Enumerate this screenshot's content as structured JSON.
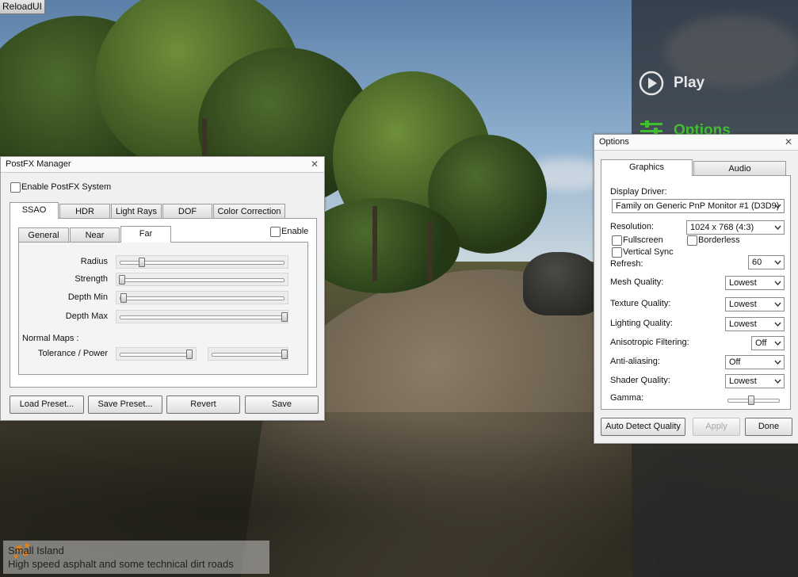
{
  "reload_ui": {
    "label": "ReloadUI"
  },
  "main_menu": {
    "play_label": "Play",
    "options_label": "Options",
    "accent_color": "#3fbf2e"
  },
  "postfx": {
    "title": "PostFX Manager",
    "enable_system_label": "Enable PostFX System",
    "enable_system_checked": false,
    "tabs": [
      {
        "label": "SSAO",
        "active": true
      },
      {
        "label": "HDR",
        "active": false
      },
      {
        "label": "Light Rays",
        "active": false
      },
      {
        "label": "DOF",
        "active": false
      },
      {
        "label": "Color Correction",
        "active": false
      }
    ],
    "subtabs": [
      {
        "label": "General",
        "active": false
      },
      {
        "label": "Near",
        "active": false
      },
      {
        "label": "Far",
        "active": true
      }
    ],
    "enable_label": "Enable",
    "enable_checked": false,
    "sliders": {
      "radius": {
        "label": "Radius",
        "value": 0.15
      },
      "strength": {
        "label": "Strength",
        "value": 0.0
      },
      "depth_min": {
        "label": "Depth Min",
        "value": 0.01
      },
      "depth_max": {
        "label": "Depth Max",
        "value": 1.0
      }
    },
    "normal_maps_label": "Normal Maps :",
    "tolerance_power": {
      "label": "Tolerance / Power",
      "tolerance_value": 0.95,
      "power_value": 1.0
    },
    "buttons": {
      "load_preset": "Load Preset...",
      "save_preset": "Save Preset...",
      "revert": "Revert",
      "save": "Save"
    }
  },
  "options": {
    "title": "Options",
    "tabs": [
      {
        "label": "Graphics",
        "active": true
      },
      {
        "label": "Audio",
        "active": false
      }
    ],
    "display_driver": {
      "label": "Display Driver:",
      "value": "Family on Generic PnP Monitor #1 (D3D9)"
    },
    "resolution": {
      "label": "Resolution:",
      "value": "1024 x 768  (4:3)"
    },
    "fullscreen": {
      "label": "Fullscreen",
      "checked": false
    },
    "borderless": {
      "label": "Borderless",
      "checked": false
    },
    "vertical_sync": {
      "label": "Vertical Sync",
      "checked": false
    },
    "refresh": {
      "label": "Refresh:",
      "value": "60"
    },
    "mesh_quality": {
      "label": "Mesh Quality:",
      "value": "Lowest"
    },
    "texture_quality": {
      "label": "Texture Quality:",
      "value": "Lowest"
    },
    "lighting_quality": {
      "label": "Lighting Quality:",
      "value": "Lowest"
    },
    "anisotropic": {
      "label": "Anisotropic Filtering:",
      "value": "Off"
    },
    "antialiasing": {
      "label": "Anti-aliasing:",
      "value": "Off"
    },
    "shader_quality": {
      "label": "Shader Quality:",
      "value": "Lowest"
    },
    "gamma": {
      "label": "Gamma:",
      "value": 0.45
    },
    "buttons": {
      "auto_detect": "Auto Detect Quality",
      "apply": "Apply",
      "done": "Done"
    }
  },
  "level_info": {
    "name": "Small Island",
    "description": "High speed asphalt and some technical dirt roads"
  }
}
